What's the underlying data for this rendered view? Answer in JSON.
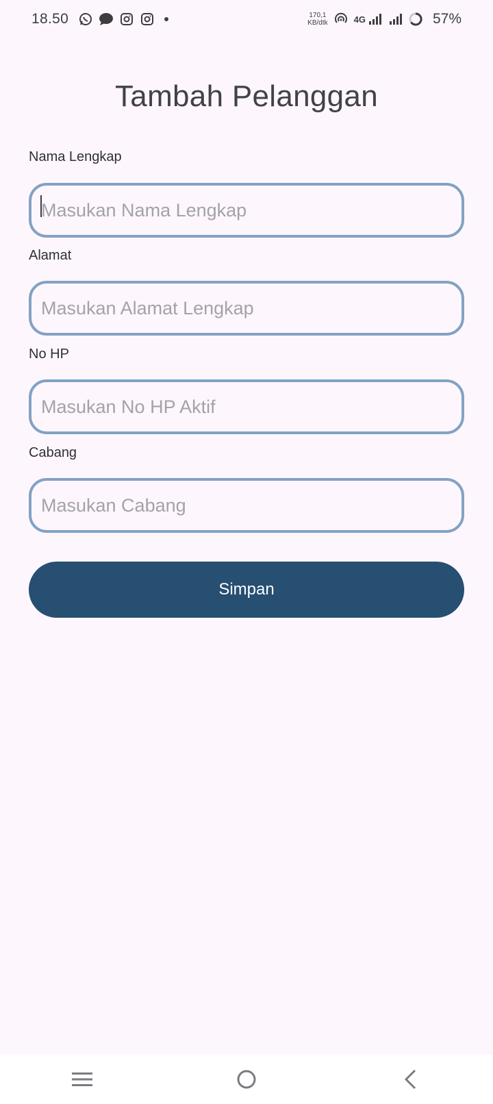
{
  "status_bar": {
    "time": "18.50",
    "net_speed_value": "170,1",
    "net_speed_unit": "KB/dtk",
    "network_type": "4G",
    "battery": "57%",
    "notification_icons": [
      "whatsapp-icon",
      "chat-bubble-icon",
      "instagram-icon",
      "instagram-icon"
    ]
  },
  "page": {
    "title": "Tambah Pelanggan"
  },
  "form": {
    "fields": [
      {
        "label": "Nama Lengkap",
        "placeholder": "Masukan Nama Lengkap",
        "value": ""
      },
      {
        "label": "Alamat",
        "placeholder": "Masukan Alamat Lengkap",
        "value": ""
      },
      {
        "label": "No HP",
        "placeholder": "Masukan No HP Aktif",
        "value": ""
      },
      {
        "label": "Cabang",
        "placeholder": "Masukan Cabang",
        "value": ""
      }
    ],
    "submit_label": "Simpan"
  },
  "nav_bar": {
    "buttons": [
      "menu-icon",
      "home-icon",
      "back-icon"
    ]
  },
  "colors": {
    "background": "#fdf7fd",
    "input_border": "#83a2c3",
    "button": "#264f72",
    "button_text": "#ffffff",
    "placeholder": "#a3a2a8"
  }
}
